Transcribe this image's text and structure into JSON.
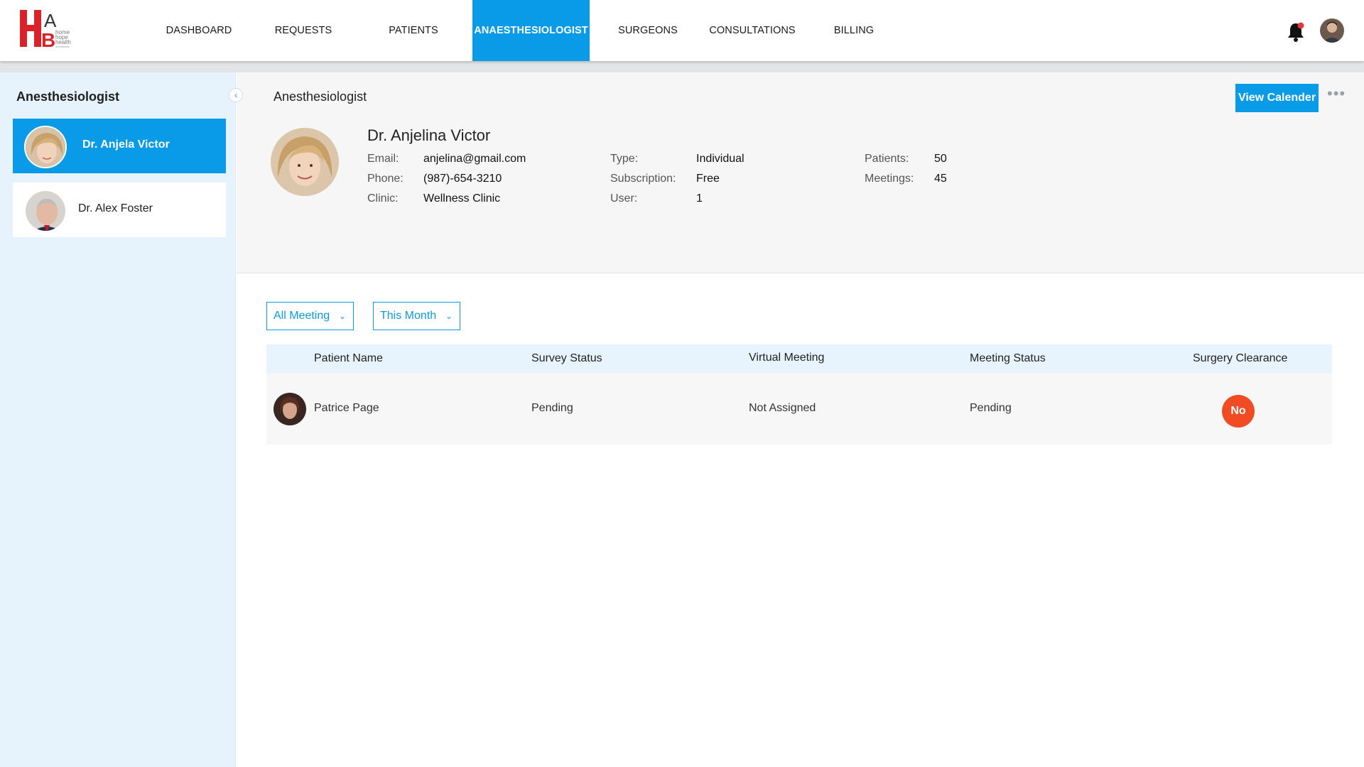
{
  "brand": {
    "logo_text": "HAB home hope health anesthesia"
  },
  "nav": {
    "items": [
      {
        "label": "DASHBOARD"
      },
      {
        "label": "REQUESTS"
      },
      {
        "label": "PATIENTS"
      },
      {
        "label": "ANAESTHESIOLOGIST",
        "active": true
      },
      {
        "label": "SURGEONS"
      },
      {
        "label": "CONSULTATIONS"
      },
      {
        "label": "BILLING"
      }
    ],
    "icons": [
      "bell-icon",
      "user-avatar"
    ]
  },
  "sidebar": {
    "title": "Anesthesiologist",
    "collapse_icon": "chevron-left-icon",
    "items": [
      {
        "name": "Dr. Anjela Victor",
        "active": true
      },
      {
        "name": "Dr. Alex Foster",
        "active": false
      }
    ]
  },
  "profile": {
    "section_title": "Anesthesiologist",
    "view_calendar_label": "View Calender",
    "more_label": "•••",
    "name": "Dr. Anjelina Victor",
    "fields": {
      "email_label": "Email:",
      "email": "anjelina@gmail.com",
      "phone_label": "Phone:",
      "phone": "(987)-654-3210",
      "clinic_label": "Clinic:",
      "clinic": "Wellness Clinic",
      "type_label": "Type:",
      "type": "Individual",
      "subscription_label": "Subscription:",
      "subscription": "Free",
      "user_label": "User:",
      "user": "1",
      "patients_label": "Patients:",
      "patients": "50",
      "meetings_label": "Meetings:",
      "meetings": "45"
    }
  },
  "filters": {
    "meeting": "All Meeting",
    "period": "This Month"
  },
  "table": {
    "columns": [
      "Patient Name",
      "Survey Status",
      "Virtual Meeting",
      "Meeting Status",
      "Surgery Clearance"
    ],
    "rows": [
      {
        "patient": "Patrice Page",
        "survey": "Pending",
        "virtual": "Not Assigned",
        "meeting": "Pending",
        "clearance": "No"
      }
    ]
  },
  "colors": {
    "accent": "#0a9be8",
    "sidebar_bg": "#e6f3fc",
    "clearance_no": "#f04b23"
  }
}
